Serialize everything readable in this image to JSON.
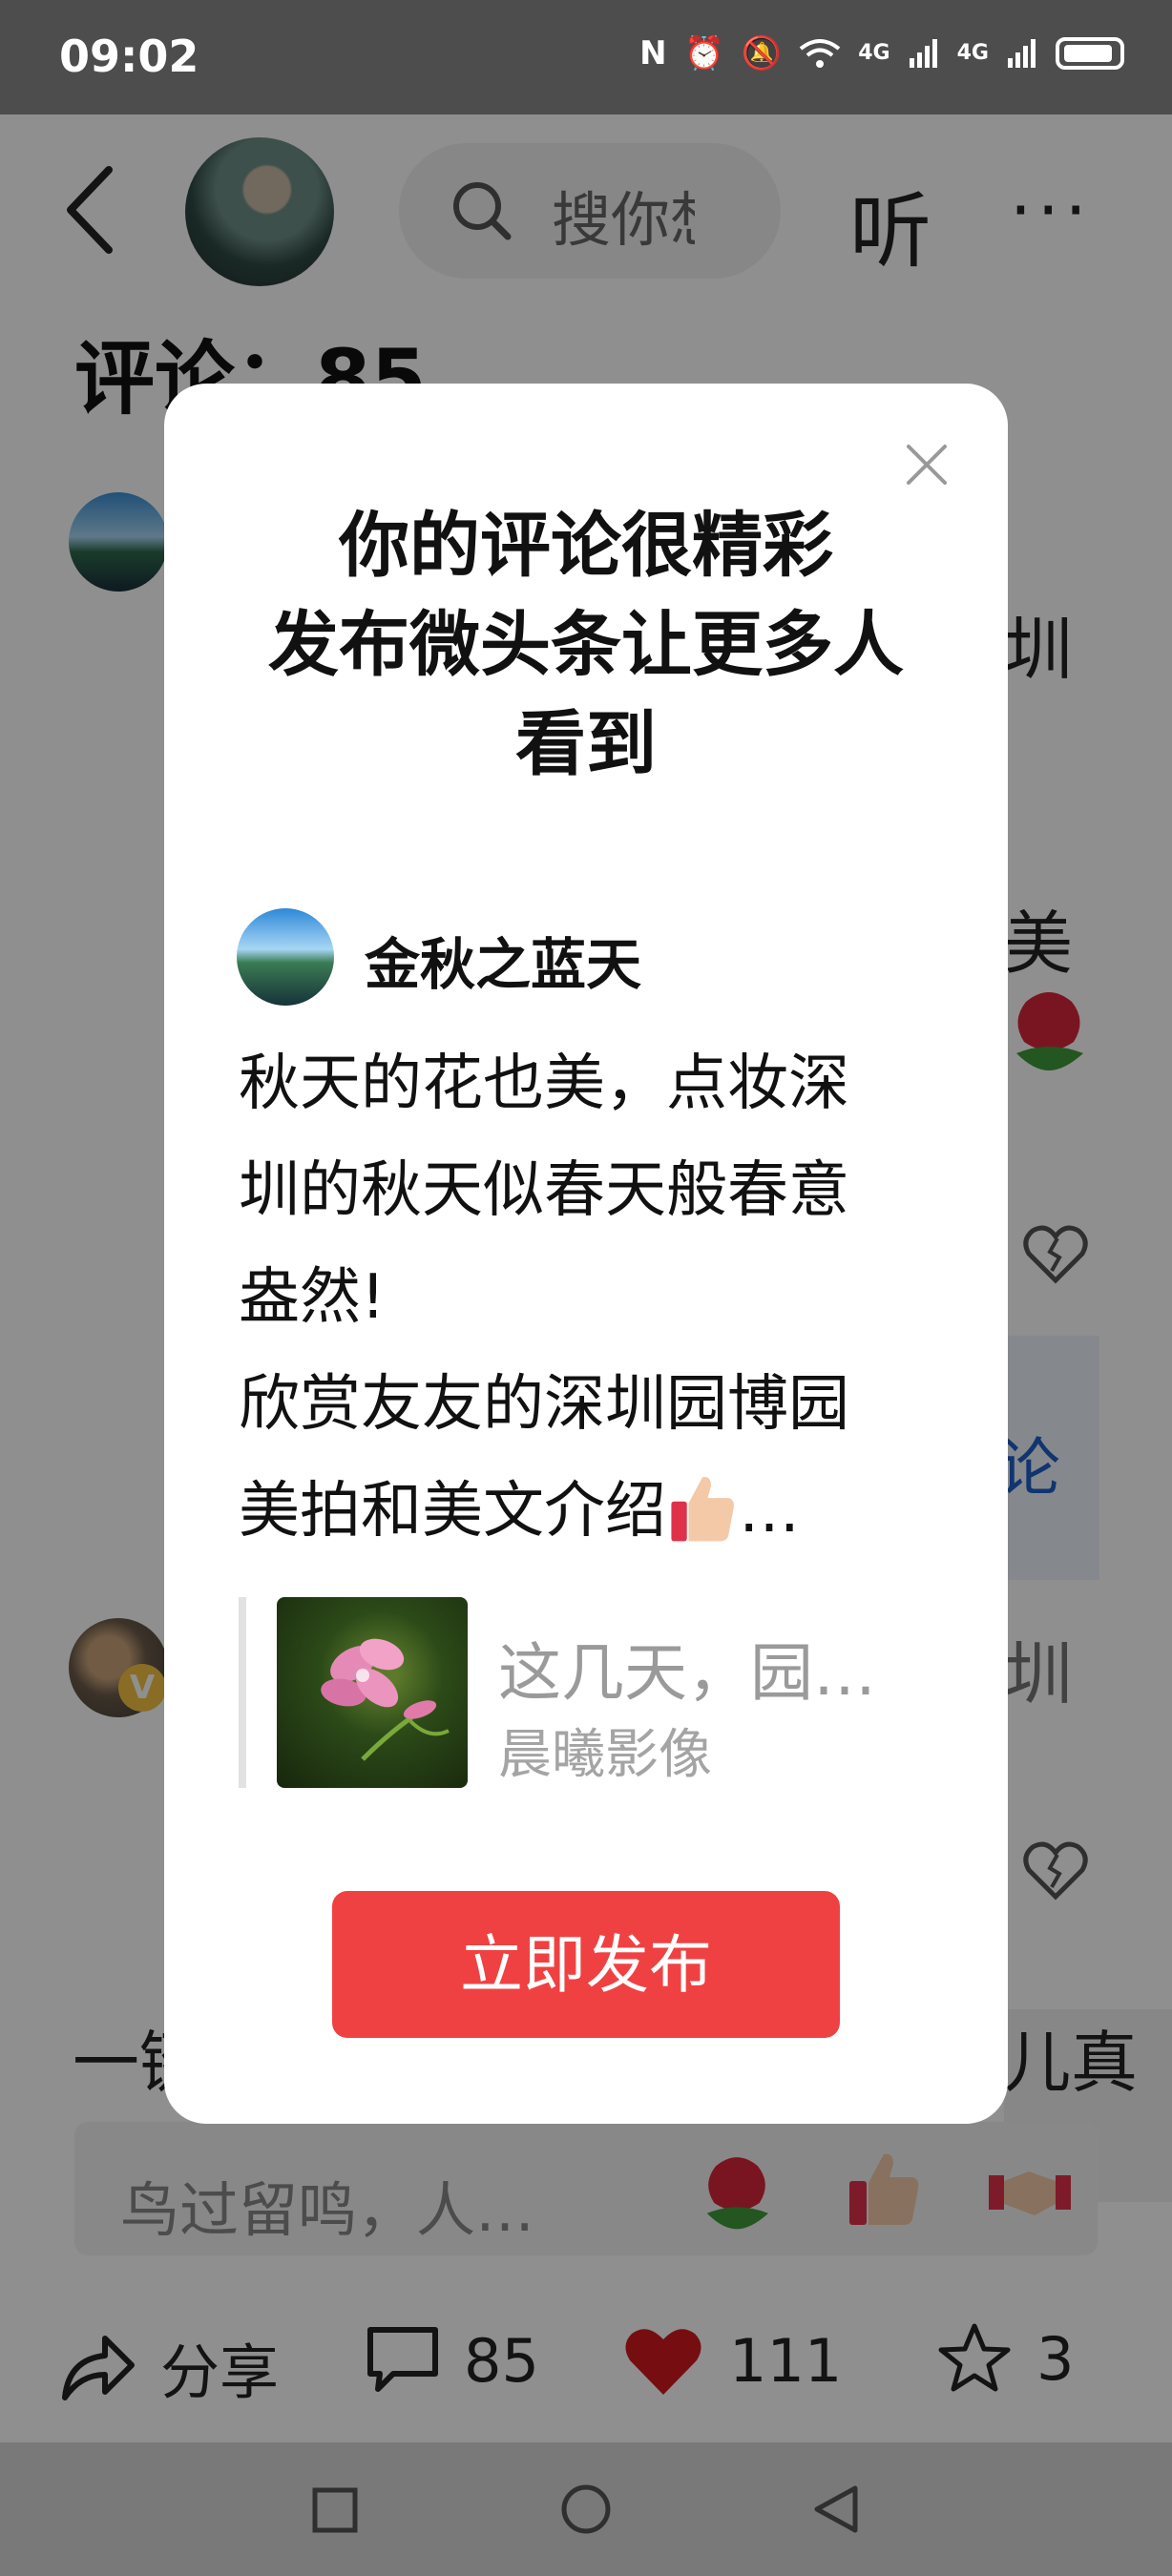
{
  "status_bar": {
    "time": "09:02",
    "network_1": "4G",
    "network_2": "4G"
  },
  "header": {
    "search_placeholder": "搜你想",
    "listen_label": "听",
    "more_label": "···"
  },
  "comments": {
    "title": "评论：85"
  },
  "background_fragments": {
    "frag_1": "圳",
    "frag_2": "美",
    "frag_3": "论",
    "frag_4": "圳",
    "bottom_left": "一键",
    "bottom_right": "儿真好"
  },
  "comment_input": {
    "placeholder": "鸟过留鸣，人…"
  },
  "action_bar": {
    "share_label": "分享",
    "comment_count": "85",
    "like_count": "111",
    "favorite_count": "3"
  },
  "modal": {
    "title_line1": "你的评论很精彩",
    "title_line2": "发布微头条让更多人",
    "title_line3": "看到",
    "user_name": "金秋之蓝天",
    "comment_line1": "秋天的花也美，点妆深",
    "comment_line2": "圳的秋天似春天般春意",
    "comment_line3": "盎然!",
    "comment_line4": "欣赏友友的深圳园博园",
    "comment_line5_text": "美拍和美文介绍",
    "comment_line5_tail": "…",
    "quote_title": "这几天，园…",
    "quote_author": "晨曦影像",
    "publish_label": "立即发布"
  },
  "colors": {
    "accent_red": "#f04142",
    "overlay": "rgba(0,0,0,0.44)",
    "link_blue": "#1d5fc7"
  }
}
